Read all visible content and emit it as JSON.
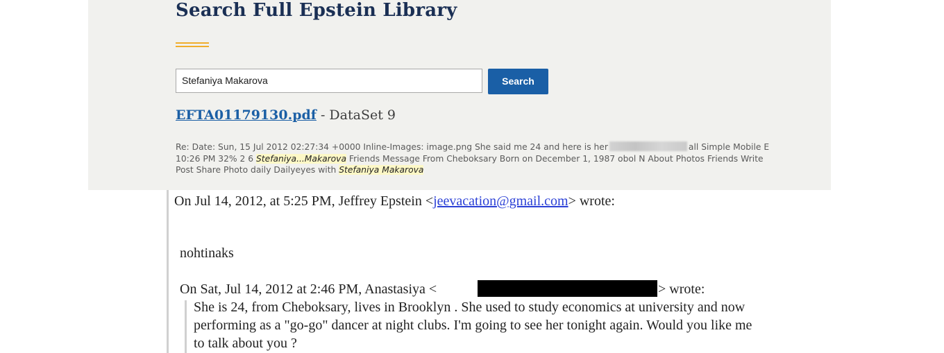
{
  "search": {
    "title": "Search Full Epstein Library",
    "query": "Stefaniya Makarova",
    "button_label": "Search"
  },
  "result": {
    "link_text": "EFTA01179130.pdf",
    "dataset": " - DataSet 9",
    "snippet": {
      "part1": "Re: Date: Sun, 15 Jul 2012 02:27:34 +0000 Inline-Images: image.png She said me 24 and here is her",
      "part2": "all Simple Mobile E 10:26 PM 32% 2 6 ",
      "hl1": "Stefaniya...Makarova",
      "part3": " Friends Message From Cheboksary Born on December 1, 1987 obol N About Photos Friends Write Post Share Photo daily Dailyeyes with ",
      "hl2": "Stefaniya Makarova"
    }
  },
  "email": {
    "header_prefix": "On Jul 14, 2012, at 5:25 PM, Jeffrey Epstein <",
    "header_email": "jeevacation@gmail.com",
    "header_suffix": "> wrote:",
    "reply": "nohtinaks",
    "quote_header_prefix": "On Sat, Jul 14, 2012 at 2:46 PM, Anastasiya <",
    "quote_header_suffix": "> wrote:",
    "quote_lines": [
      "She is 24, from Cheboksary, lives in Brooklyn . She used to study economics at university and now",
      "performing as a \"go-go\" dancer at night clubs. I'm going to see her tonight again. Would you like me",
      "to talk about you ?"
    ]
  },
  "colors": {
    "panel_bg": "#f1f1ee",
    "title": "#1a2f54",
    "accent": "#f0ad2b",
    "button": "#1a5fa6",
    "link": "#1b5fa5"
  }
}
